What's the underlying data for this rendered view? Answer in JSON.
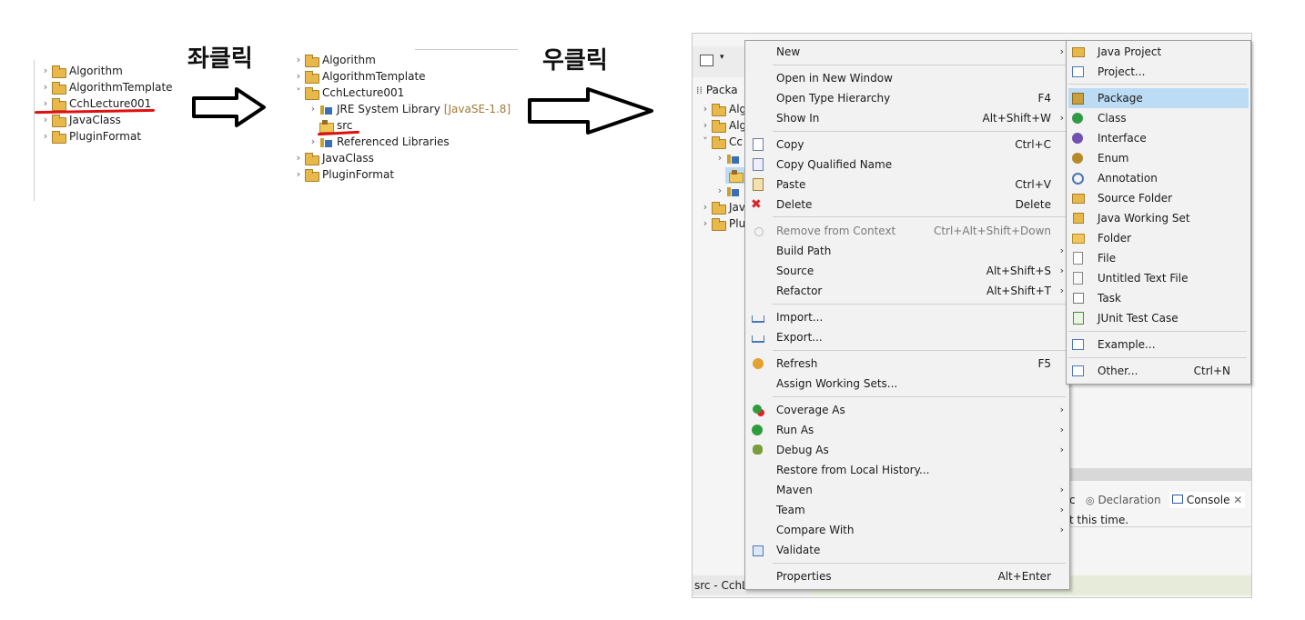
{
  "left_tree": {
    "items": [
      {
        "label": "Algorithm"
      },
      {
        "label": "AlgorithmTemplate"
      },
      {
        "label": "CchLecture001"
      },
      {
        "label": "JavaClass"
      },
      {
        "label": "PluginFormat"
      }
    ]
  },
  "step1": {
    "heading": "좌클릭"
  },
  "step2": {
    "heading": "우클릭"
  },
  "middle_tree": {
    "items": [
      {
        "label": "Algorithm"
      },
      {
        "label": "AlgorithmTemplate"
      },
      {
        "label": "CchLecture001"
      },
      {
        "label": "JRE System Library",
        "suffix": "[JavaSE-1.8]"
      },
      {
        "label": "src"
      },
      {
        "label": "Referenced Libraries"
      },
      {
        "label": "JavaClass"
      },
      {
        "label": "PluginFormat"
      }
    ]
  },
  "eclipse": {
    "tab_label": "Packa",
    "tree_partial": [
      "Alg",
      "Alg",
      "Cc",
      "Jav",
      "Plu"
    ],
    "bottom_tabs": {
      "declaration": "Declaration",
      "console": "Console",
      "partial_c": "c"
    },
    "console_text": "t this time.",
    "status_text": "src - CchL"
  },
  "context_menu": {
    "items": [
      {
        "label": "New",
        "key": "",
        "arrow": true,
        "icon": ""
      },
      {
        "label": "Open in New Window",
        "key": "",
        "icon": ""
      },
      {
        "label": "Open Type Hierarchy",
        "key": "F4",
        "icon": ""
      },
      {
        "label": "Show In",
        "key": "Alt+Shift+W",
        "arrow": true,
        "icon": ""
      },
      {
        "label": "Copy",
        "key": "Ctrl+C",
        "icon": "copy-icon"
      },
      {
        "label": "Copy Qualified Name",
        "key": "",
        "icon": "copy-qualified-icon"
      },
      {
        "label": "Paste",
        "key": "Ctrl+V",
        "icon": "paste-icon"
      },
      {
        "label": "Delete",
        "key": "Delete",
        "icon": "delete-icon"
      },
      {
        "label": "Remove from Context",
        "key": "Ctrl+Alt+Shift+Down",
        "icon": "remove-context-icon",
        "disabled": true
      },
      {
        "label": "Build Path",
        "key": "",
        "arrow": true,
        "icon": ""
      },
      {
        "label": "Source",
        "key": "Alt+Shift+S",
        "arrow": true,
        "icon": ""
      },
      {
        "label": "Refactor",
        "key": "Alt+Shift+T",
        "arrow": true,
        "icon": ""
      },
      {
        "label": "Import...",
        "key": "",
        "icon": "import-icon"
      },
      {
        "label": "Export...",
        "key": "",
        "icon": "export-icon"
      },
      {
        "label": "Refresh",
        "key": "F5",
        "icon": "refresh-icon"
      },
      {
        "label": "Assign Working Sets...",
        "key": "",
        "icon": ""
      },
      {
        "label": "Coverage As",
        "key": "",
        "arrow": true,
        "icon": "coverage-icon"
      },
      {
        "label": "Run As",
        "key": "",
        "arrow": true,
        "icon": "run-icon"
      },
      {
        "label": "Debug As",
        "key": "",
        "arrow": true,
        "icon": "debug-icon"
      },
      {
        "label": "Restore from Local History...",
        "key": "",
        "icon": ""
      },
      {
        "label": "Maven",
        "key": "",
        "arrow": true,
        "icon": ""
      },
      {
        "label": "Team",
        "key": "",
        "arrow": true,
        "icon": ""
      },
      {
        "label": "Compare With",
        "key": "",
        "arrow": true,
        "icon": ""
      },
      {
        "label": "Validate",
        "key": "",
        "icon": "validate-icon"
      },
      {
        "label": "Properties",
        "key": "Alt+Enter",
        "icon": ""
      }
    ]
  },
  "new_submenu": {
    "items": [
      {
        "label": "Java Project",
        "key": "",
        "icon": "java-project-icon"
      },
      {
        "label": "Project...",
        "key": "",
        "icon": "project-icon"
      },
      {
        "label": "Package",
        "key": "",
        "icon": "package-icon",
        "selected": true
      },
      {
        "label": "Class",
        "key": "",
        "icon": "class-icon"
      },
      {
        "label": "Interface",
        "key": "",
        "icon": "interface-icon"
      },
      {
        "label": "Enum",
        "key": "",
        "icon": "enum-icon"
      },
      {
        "label": "Annotation",
        "key": "",
        "icon": "annotation-icon"
      },
      {
        "label": "Source Folder",
        "key": "",
        "icon": "source-folder-icon"
      },
      {
        "label": "Java Working Set",
        "key": "",
        "icon": "working-set-icon"
      },
      {
        "label": "Folder",
        "key": "",
        "icon": "folder-icon"
      },
      {
        "label": "File",
        "key": "",
        "icon": "file-icon"
      },
      {
        "label": "Untitled Text File",
        "key": "",
        "icon": "text-file-icon"
      },
      {
        "label": "Task",
        "key": "",
        "icon": "task-icon"
      },
      {
        "label": "JUnit Test Case",
        "key": "",
        "icon": "junit-icon"
      },
      {
        "label": "Example...",
        "key": "",
        "icon": "example-icon"
      },
      {
        "label": "Other...",
        "key": "Ctrl+N",
        "icon": "other-icon"
      }
    ]
  },
  "colors": {
    "selection": "#bcdcf6",
    "menu_bg": "#f2f2f2",
    "red_marker": "#e01010",
    "folder": "#e8b84a"
  }
}
